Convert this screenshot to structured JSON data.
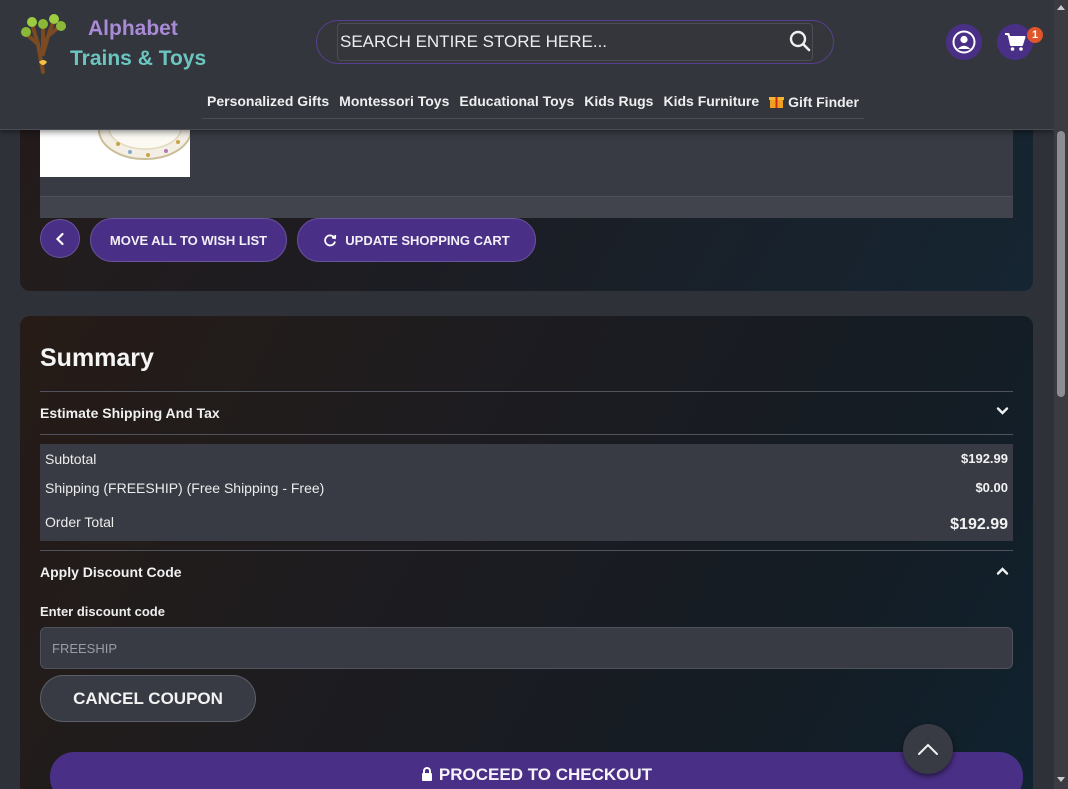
{
  "header": {
    "logo_line1": "Alphabet",
    "logo_line2": "Trains & Toys",
    "search_placeholder": "SEARCH ENTIRE STORE HERE...",
    "cart_count": "1",
    "nav": [
      {
        "label": "Personalized Gifts"
      },
      {
        "label": "Montessori Toys"
      },
      {
        "label": "Educational Toys"
      },
      {
        "label": "Kids Rugs"
      },
      {
        "label": "Kids Furniture"
      },
      {
        "label": "Gift Finder"
      }
    ]
  },
  "cart_actions": {
    "wish_label": "MOVE ALL TO WISH LIST",
    "update_label": "UPDATE SHOPPING CART"
  },
  "summary": {
    "title": "Summary",
    "shipping_section": "Estimate Shipping And Tax",
    "subtotal_label": "Subtotal",
    "subtotal_value": "$192.99",
    "shipping_label": "Shipping (FREESHIP) (Free Shipping - Free)",
    "shipping_value": "$0.00",
    "total_label": "Order Total",
    "total_value": "$192.99",
    "discount_section": "Apply Discount Code",
    "discount_field_label": "Enter discount code",
    "discount_value": "FREESHIP",
    "cancel_label": "CANCEL COUPON",
    "checkout_label": "PROCEED TO CHECKOUT"
  },
  "colors": {
    "accent": "#4a2f86",
    "background": "#2e3138",
    "badge": "#e0552a"
  },
  "icons": [
    "tree-logo-icon",
    "search-icon",
    "account-icon",
    "cart-icon",
    "gift-icon",
    "chevron-left-icon",
    "refresh-icon",
    "chevron-down-icon",
    "chevron-up-icon",
    "lock-icon",
    "arrow-up-icon"
  ]
}
